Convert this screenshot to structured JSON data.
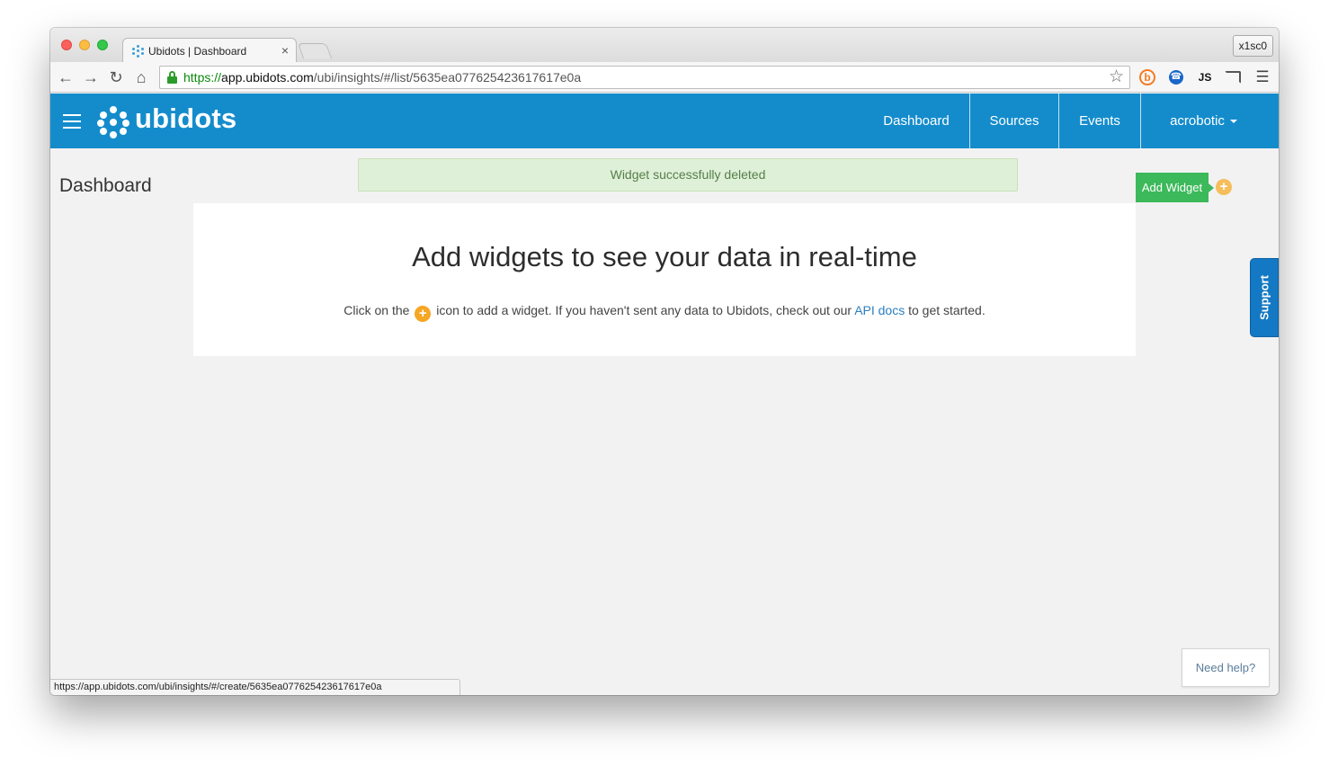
{
  "browser": {
    "tab_title": "Ubidots | Dashboard",
    "tab_close": "×",
    "profile": "x1sc0",
    "url_scheme": "https://",
    "url_host": "app.ubidots.com",
    "url_path": "/ubi/insights/#/list/5635ea077625423617617e0a",
    "status_url": "https://app.ubidots.com/ubi/insights/#/create/5635ea077625423617617e0a",
    "icons": [
      "back-icon",
      "forward-icon",
      "reload-icon",
      "home-icon",
      "lock-icon",
      "star-icon",
      "b-extension-icon",
      "phone-extension-icon",
      "js-extension-icon",
      "cast-icon",
      "menu-icon"
    ],
    "ext_js": "JS"
  },
  "app": {
    "logo": "ubidots",
    "brand_color": "#148ccc",
    "nav": {
      "dashboard": "Dashboard",
      "sources": "Sources",
      "events": "Events",
      "user": "acrobotic"
    }
  },
  "page": {
    "title": "Dashboard",
    "alert": "Widget successfully deleted",
    "add_widget": "Add Widget",
    "empty_heading": "Add widgets to see your data in real-time",
    "empty_text_before": "Click on the",
    "empty_text_after": "icon to add a widget. If you haven't sent any data to Ubidots, check out our",
    "empty_link": "API docs",
    "empty_text_end": "to get started.",
    "support": "Support",
    "need_help": "Need help?",
    "colors": {
      "success_button": "#3cb95a",
      "alert_background": "#dff0d8",
      "plus_icon": "#f5a623",
      "support_tab": "#1479c4"
    }
  }
}
